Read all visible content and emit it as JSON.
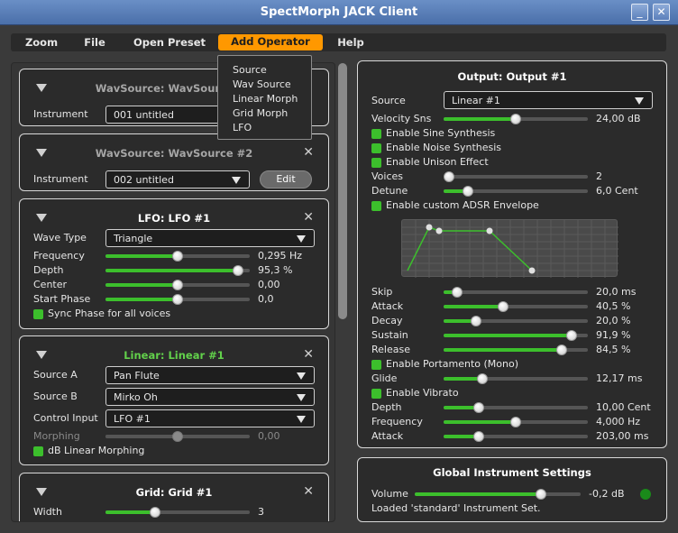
{
  "window": {
    "title": "SpectMorph JACK Client",
    "minimize": "_",
    "close": "✕"
  },
  "menu": {
    "items": [
      {
        "label": "Zoom"
      },
      {
        "label": "File"
      },
      {
        "label": "Open Preset"
      },
      {
        "label": "Add Operator",
        "active": true
      },
      {
        "label": "Help"
      }
    ],
    "dropdown": [
      "Source",
      "Wav Source",
      "Linear Morph",
      "Grid Morph",
      "LFO"
    ]
  },
  "operators": {
    "wav1": {
      "title": "WavSource: WavSource #1",
      "instrument_label": "Instrument",
      "instrument_value": "001 untitled"
    },
    "wav2": {
      "title": "WavSource: WavSource #2",
      "instrument_label": "Instrument",
      "instrument_value": "002 untitled",
      "edit": "Edit",
      "close": "✕"
    },
    "lfo": {
      "title": "LFO: LFO #1",
      "close": "✕",
      "wave_label": "Wave Type",
      "wave_value": "Triangle",
      "params": [
        {
          "label": "Frequency",
          "value": "0,295 Hz",
          "level": 0.5
        },
        {
          "label": "Depth",
          "value": "95,3 %",
          "level": 0.953
        },
        {
          "label": "Center",
          "value": "0,00",
          "level": 0.5
        },
        {
          "label": "Start Phase",
          "value": "0,0",
          "level": 0.5
        }
      ],
      "sync": "Sync Phase for all voices"
    },
    "linear": {
      "title": "Linear: Linear #1",
      "close": "✕",
      "source_a_label": "Source A",
      "source_a": "Pan Flute",
      "source_b_label": "Source B",
      "source_b": "Mirko Oh",
      "control_label": "Control Input",
      "control": "LFO #1",
      "morphing_label": "Morphing",
      "morphing_value": "0,00",
      "morphing_level": 0.5,
      "db_label": "dB Linear Morphing"
    },
    "grid": {
      "title": "Grid: Grid #1",
      "close": "✕",
      "width_label": "Width",
      "width_value": "3",
      "width_level": 0.33
    }
  },
  "output": {
    "title": "Output: Output #1",
    "source_label": "Source",
    "source_value": "Linear #1",
    "velocity": {
      "label": "Velocity Sns",
      "value": "24,00 dB",
      "level": 0.5
    },
    "checks1": [
      "Enable Sine Synthesis",
      "Enable Noise Synthesis",
      "Enable Unison Effect"
    ],
    "voices": {
      "label": "Voices",
      "value": "2",
      "level": 0.0
    },
    "detune": {
      "label": "Detune",
      "value": "6,0 Cent",
      "level": 0.14
    },
    "adsr_check": "Enable custom ADSR Envelope",
    "adsr": [
      {
        "label": "Skip",
        "value": "20,0 ms",
        "level": 0.06
      },
      {
        "label": "Attack",
        "value": "40,5 %",
        "level": 0.405
      },
      {
        "label": "Decay",
        "value": "20,0 %",
        "level": 0.2
      },
      {
        "label": "Sustain",
        "value": "91,9 %",
        "level": 0.919
      },
      {
        "label": "Release",
        "value": "84,5 %",
        "level": 0.845
      }
    ],
    "portamento_check": "Enable Portamento (Mono)",
    "glide": {
      "label": "Glide",
      "value": "12,17 ms",
      "level": 0.25
    },
    "vibrato_check": "Enable Vibrato",
    "vibrato": [
      {
        "label": "Depth",
        "value": "10,00 Cent",
        "level": 0.22
      },
      {
        "label": "Frequency",
        "value": "4,000 Hz",
        "level": 0.5
      },
      {
        "label": "Attack",
        "value": "203,00 ms",
        "level": 0.22
      }
    ]
  },
  "global": {
    "title": "Global Instrument Settings",
    "volume_label": "Volume",
    "volume_value": "-0,2 dB",
    "volume_level": 0.78,
    "status": "Loaded 'standard' Instrument Set."
  },
  "colors": {
    "accent": "#ff9800",
    "green": "#3cbf2c",
    "title_green": "#62d14b"
  }
}
